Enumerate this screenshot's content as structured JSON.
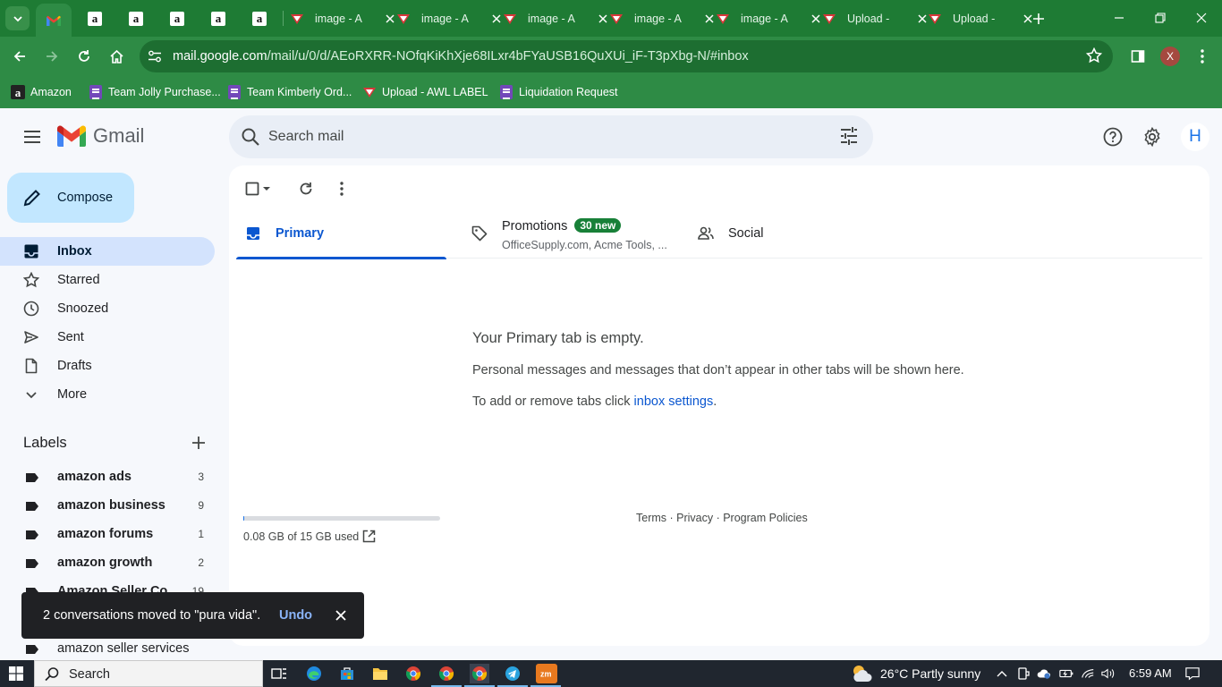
{
  "browser": {
    "tabs": [
      {
        "favicon": "gmail-icon",
        "title": "",
        "active": true
      },
      {
        "favicon": "amazon-icon",
        "title": ""
      },
      {
        "favicon": "amazon-icon",
        "title": ""
      },
      {
        "favicon": "amazon-icon",
        "title": ""
      },
      {
        "favicon": "amazon-icon",
        "title": ""
      },
      {
        "favicon": "amazon-icon",
        "title": ""
      },
      {
        "favicon": "awl-icon",
        "title": "image - A"
      },
      {
        "favicon": "awl-icon",
        "title": "image - A"
      },
      {
        "favicon": "awl-icon",
        "title": "image - A"
      },
      {
        "favicon": "awl-icon",
        "title": "image - A"
      },
      {
        "favicon": "awl-icon",
        "title": "image - A"
      },
      {
        "favicon": "awl-icon",
        "title": "Upload -"
      },
      {
        "favicon": "awl-icon",
        "title": "Upload -"
      }
    ],
    "url_host": "mail.google.com",
    "url_path": "/mail/u/0/d/AEoRXRR-NOfqKiKhXje68ILxr4bFYaUSB16QuXUi_iF-T3pXbg-N/#inbox",
    "profile_initial": "X",
    "bookmarks": [
      {
        "icon": "amazon-icon",
        "label": "Amazon"
      },
      {
        "icon": "forms-icon",
        "label": "Team Jolly Purchase..."
      },
      {
        "icon": "forms-icon",
        "label": "Team Kimberly Ord..."
      },
      {
        "icon": "awl-icon",
        "label": "Upload - AWL LABEL"
      },
      {
        "icon": "forms-icon",
        "label": "Liquidation Request"
      }
    ]
  },
  "gmail": {
    "app_name": "Gmail",
    "search_placeholder": "Search mail",
    "avatar_initial": "H",
    "compose_label": "Compose",
    "nav": [
      {
        "icon": "inbox-icon",
        "label": "Inbox",
        "active": true
      },
      {
        "icon": "star-icon",
        "label": "Starred"
      },
      {
        "icon": "clock-icon",
        "label": "Snoozed"
      },
      {
        "icon": "send-icon",
        "label": "Sent"
      },
      {
        "icon": "draft-icon",
        "label": "Drafts"
      },
      {
        "icon": "chevron-down-icon",
        "label": "More"
      }
    ],
    "labels_title": "Labels",
    "labels": [
      {
        "name": "amazon ads",
        "count": "3"
      },
      {
        "name": "amazon business",
        "count": "9"
      },
      {
        "name": "amazon forums",
        "count": "1"
      },
      {
        "name": "amazon growth",
        "count": "2"
      },
      {
        "name": "Amazon Seller Co...",
        "count": "19"
      },
      {
        "name": "amazon seller services",
        "count": ""
      }
    ],
    "tabs": {
      "primary": "Primary",
      "promotions": "Promotions",
      "promotions_badge": "30 new",
      "promotions_sub": "OfficeSupply.com, Acme Tools, ...",
      "social": "Social"
    },
    "empty": {
      "title": "Your Primary tab is empty.",
      "text": "Personal messages and messages that don’t appear in other tabs will be shown here.",
      "hint_prefix": "To add or remove tabs click ",
      "hint_link": "inbox settings",
      "hint_suffix": "."
    },
    "storage": {
      "text": "0.08 GB of 15 GB used",
      "used_fraction": 0.0053
    },
    "footer": "Terms · Privacy · Program Policies",
    "snackbar": {
      "message": "2 conversations moved to \"pura vida\".",
      "action": "Undo"
    }
  },
  "taskbar": {
    "search_label": "Search",
    "weather": "26°C  Partly sunny",
    "time": "6:59 AM"
  },
  "colors": {
    "chrome_frame": "#1e7b34",
    "chrome_toolbar": "#2e8b45",
    "gmail_bg": "#f6f8fc",
    "compose_bg": "#c2e7ff",
    "active_nav_bg": "#d3e3fd",
    "accent_blue": "#0b57d0",
    "promo_badge": "#188038"
  }
}
